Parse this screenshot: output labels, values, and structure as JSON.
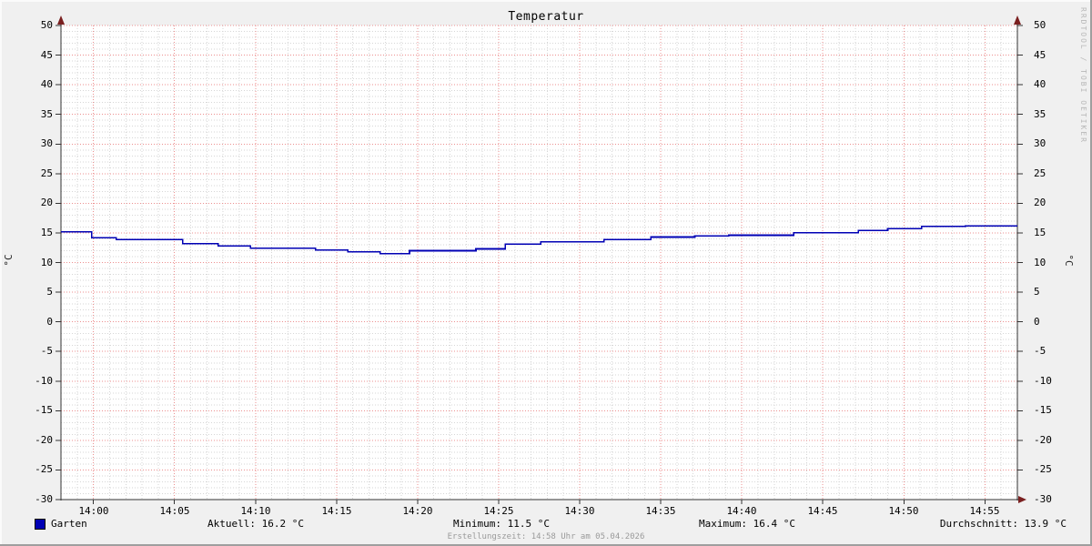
{
  "title": "Temperatur",
  "watermark": "RRDTOOL / TOBI OETIKER",
  "y_axis": {
    "unit_left": "°C",
    "unit_right": "°C"
  },
  "legend": {
    "series_label": "Garten",
    "series_color": "#0000b4",
    "stats": [
      {
        "name": "aktuell",
        "text": "Aktuell: 16.2 °C"
      },
      {
        "name": "minimum",
        "text": "Minimum: 11.5 °C"
      },
      {
        "name": "maximum",
        "text": "Maximum: 16.4 °C"
      },
      {
        "name": "durchschnitt",
        "text": "Durchschnitt: 13.9 °C"
      }
    ]
  },
  "footer": {
    "creation_text": "Erstellungszeit: 14:58 Uhr am 05.04.2026"
  },
  "colors": {
    "background": "#f0f0f0",
    "plot_background": "#ffffff",
    "grid_minor": "#d6d6d6",
    "grid_major": "#ec8f8f",
    "axis": "#333333",
    "arrow": "#7a2020",
    "line": "#0000b4",
    "watermark_text": "#b8b8b8",
    "footer_text": "#9a9a9a"
  },
  "chart_data": {
    "type": "line",
    "style": "step",
    "title": "Temperatur",
    "ylabel": "°C",
    "ylim": [
      -30,
      50
    ],
    "y_tick_step": 5,
    "y_tick_labels": [
      "50",
      "45",
      "40",
      "35",
      "30",
      "25",
      "20",
      "15",
      "10",
      "5",
      "0",
      "-5",
      "-10",
      "-15",
      "-20",
      "-25",
      "-30"
    ],
    "x_start": "13:58",
    "x_end": "14:57",
    "x_total_minutes": 59,
    "x_minor_step_minutes": 1,
    "grid": true,
    "legend_position": "bottom",
    "x_ticks": [
      {
        "minute": 2,
        "label": "14:00"
      },
      {
        "minute": 7,
        "label": "14:05"
      },
      {
        "minute": 12,
        "label": "14:10"
      },
      {
        "minute": 17,
        "label": "14:15"
      },
      {
        "minute": 22,
        "label": "14:20"
      },
      {
        "minute": 27,
        "label": "14:25"
      },
      {
        "minute": 32,
        "label": "14:30"
      },
      {
        "minute": 37,
        "label": "14:35"
      },
      {
        "minute": 42,
        "label": "14:40"
      },
      {
        "minute": 47,
        "label": "14:45"
      },
      {
        "minute": 52,
        "label": "14:50"
      },
      {
        "minute": 57,
        "label": "14:55"
      }
    ],
    "series": [
      {
        "name": "Garten",
        "color": "#0000b4",
        "points_minutes_value": [
          [
            0,
            15.2
          ],
          [
            1.9,
            14.2
          ],
          [
            3.4,
            13.9
          ],
          [
            7.5,
            13.2
          ],
          [
            9.7,
            12.8
          ],
          [
            11.7,
            12.4
          ],
          [
            15.7,
            12.1
          ],
          [
            17.7,
            11.8
          ],
          [
            19.7,
            11.5
          ],
          [
            21.5,
            12.0
          ],
          [
            25.6,
            12.3
          ],
          [
            27.4,
            13.1
          ],
          [
            29.6,
            13.5
          ],
          [
            33.5,
            13.9
          ],
          [
            36.4,
            14.3
          ],
          [
            39.1,
            14.5
          ],
          [
            41.2,
            14.6
          ],
          [
            45.2,
            15.0
          ],
          [
            49.2,
            15.4
          ],
          [
            51.0,
            15.7
          ],
          [
            53.1,
            16.1
          ],
          [
            55.8,
            16.2
          ]
        ]
      }
    ],
    "stats": {
      "aktuell_c": 16.2,
      "minimum_c": 11.5,
      "maximum_c": 16.4,
      "durchschnitt_c": 13.9
    }
  }
}
